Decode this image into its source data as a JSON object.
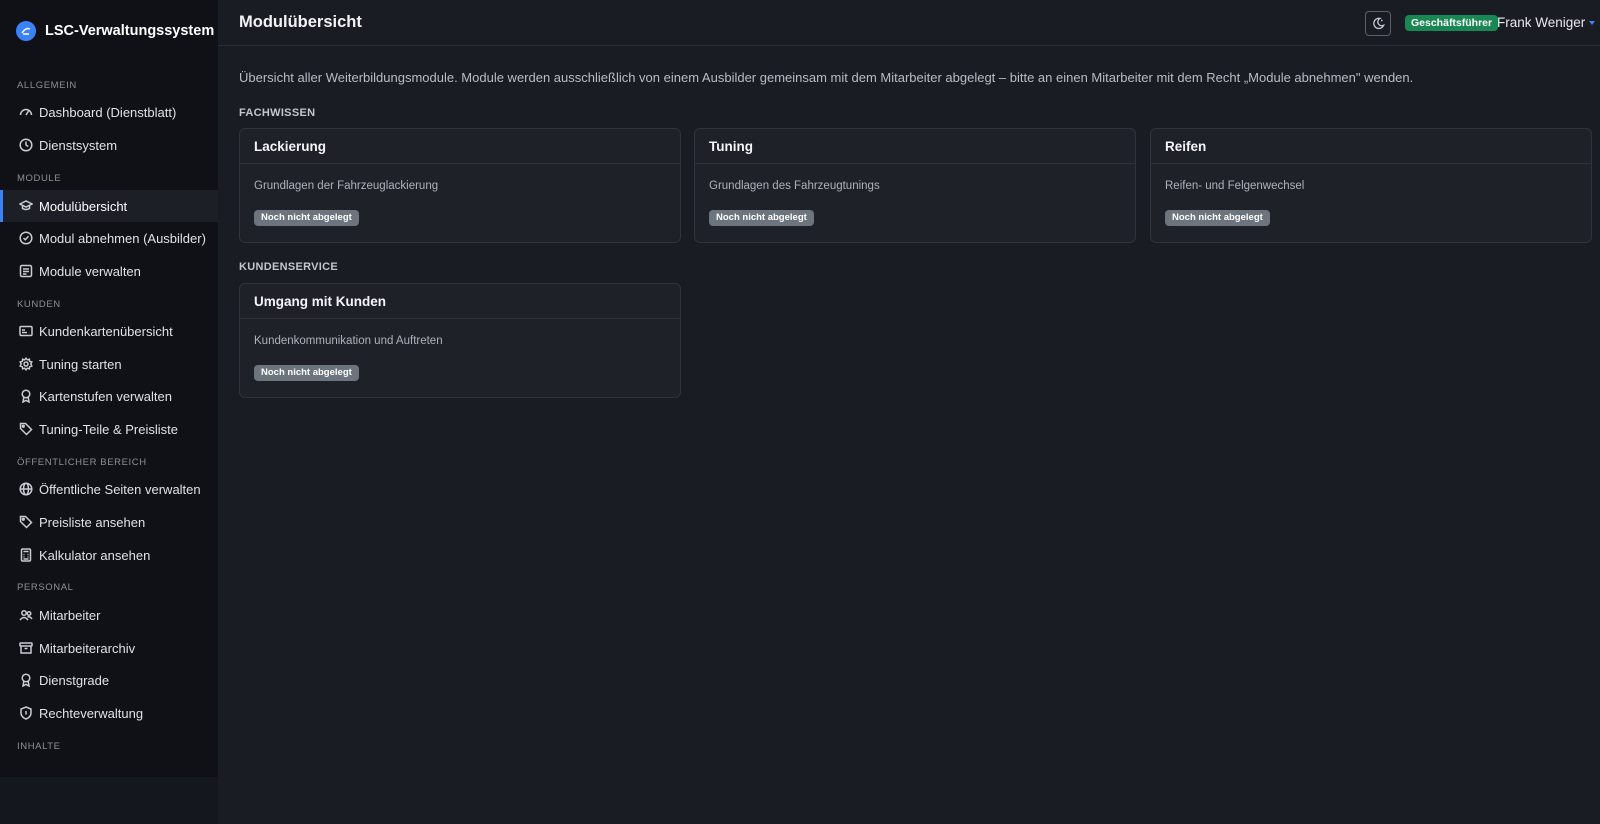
{
  "sidebar": {
    "brand": "LSC-Verwaltungssystem",
    "sections": [
      {
        "title": "ALLGEMEIN"
      },
      {
        "title": "MODULE"
      },
      {
        "title": "KUNDEN"
      },
      {
        "title": "ÖFFENTLICHER BEREICH"
      },
      {
        "title": "PERSONAL"
      },
      {
        "title": "INHALTE"
      }
    ],
    "items": [
      {
        "label": "Dashboard (Dienstblatt)",
        "icon": "dashboard-icon"
      },
      {
        "label": "Dienstsystem",
        "icon": "clock-icon"
      },
      {
        "label": "Modulübersicht",
        "icon": "graduation-cap-icon"
      },
      {
        "label": "Modul abnehmen (Ausbilder)",
        "icon": "check-circle-icon"
      },
      {
        "label": "Module verwalten",
        "icon": "list-icon"
      },
      {
        "label": "Kundenkartenübersicht",
        "icon": "card-icon"
      },
      {
        "label": "Tuning starten",
        "icon": "gear-icon"
      },
      {
        "label": "Kartenstufen verwalten",
        "icon": "award-icon"
      },
      {
        "label": "Tuning-Teile & Preisliste",
        "icon": "tags-icon"
      },
      {
        "label": "Öffentliche Seiten verwalten",
        "icon": "globe-icon"
      },
      {
        "label": "Preisliste ansehen",
        "icon": "tags-icon"
      },
      {
        "label": "Kalkulator ansehen",
        "icon": "calculator-icon"
      },
      {
        "label": "Mitarbeiter",
        "icon": "people-icon"
      },
      {
        "label": "Mitarbeiterarchiv",
        "icon": "archive-icon"
      },
      {
        "label": "Dienstgrade",
        "icon": "award-icon"
      },
      {
        "label": "Rechteverwaltung",
        "icon": "shield-icon"
      }
    ]
  },
  "header": {
    "title": "Modulübersicht",
    "role_badge": "Geschäftsführer",
    "user_name": "Frank Weniger"
  },
  "main": {
    "description": "Übersicht aller Weiterbildungsmodule. Module werden ausschließlich von einem Ausbilder gemeinsam mit dem Mitarbeiter abgelegt – bitte an einen Mitarbeiter mit dem Recht „Module abnehmen\" wenden.",
    "groups": [
      {
        "title": "FACHWISSEN",
        "modules": [
          {
            "title": "Lackierung",
            "description": "Grundlagen der Fahrzeuglackierung",
            "status": "Noch nicht abgelegt"
          },
          {
            "title": "Tuning",
            "description": "Grundlagen des Fahrzeugtunings",
            "status": "Noch nicht abgelegt"
          },
          {
            "title": "Reifen",
            "description": "Reifen- und Felgenwechsel",
            "status": "Noch nicht abgelegt"
          }
        ]
      },
      {
        "title": "KUNDENSERVICE",
        "modules": [
          {
            "title": "Umgang mit Kunden",
            "description": "Kundenkommunikation und Auftreten",
            "status": "Noch nicht abgelegt"
          }
        ]
      }
    ]
  },
  "colors": {
    "accent": "#3b82f6",
    "role_badge": "#198754",
    "status_badge": "#6c757d"
  }
}
